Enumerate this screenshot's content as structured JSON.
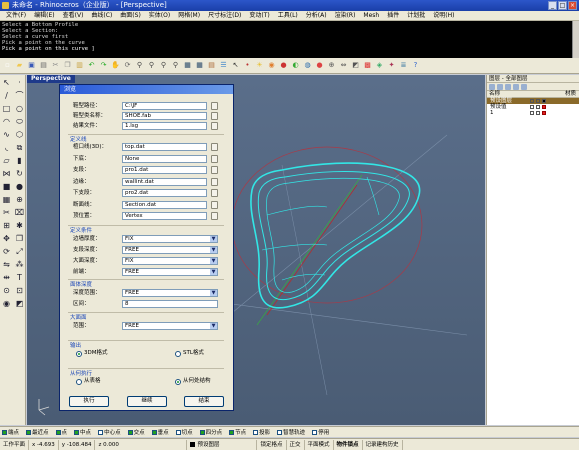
{
  "title_bar": {
    "text": "未命名 - Rhinoceros（企业版） - [Perspective]",
    "buttons": [
      "_",
      "□",
      "×"
    ]
  },
  "menu": [
    "文件(F)",
    "编辑(E)",
    "查看(V)",
    "曲线(C)",
    "曲面(S)",
    "实体(O)",
    "网格(M)",
    "尺寸标注(D)",
    "变动(T)",
    "工具(L)",
    "分析(A)",
    "渲染(R)",
    "Mesh",
    "插件",
    "计划批",
    "说明(H)"
  ],
  "command_history": [
    "Select a Bottom Profile",
    "Select a Section:",
    "Select a curve first",
    "Pick a point on the curve",
    "Pick a point on this curve ]"
  ],
  "viewport": {
    "label": "Perspective",
    "mesh_color": "#32e6e6"
  },
  "dialog": {
    "title": "浏览",
    "top_fields": [
      {
        "label": "鞋型路径：",
        "value": "C:\\JF"
      },
      {
        "label": "鞋型类名称：",
        "value": "SHOE.fab"
      },
      {
        "label": "结果文件：",
        "value": "1.lsg"
      }
    ],
    "group_define": "定义线",
    "define_fields": [
      {
        "label": "楦口线(3D)：",
        "value": "top.dat"
      },
      {
        "label": "下底：",
        "value": "None"
      },
      {
        "label": "支段：",
        "value": "pro1.dat"
      },
      {
        "label": "边缘：",
        "value": "wallint.dat"
      },
      {
        "label": "下支段：",
        "value": "pro2.dat"
      },
      {
        "label": "断面线：",
        "value": "Section.dat"
      },
      {
        "label": "顶位置：",
        "value": "Vertex"
      }
    ],
    "group_conditions": "定义条件",
    "condition_fields": [
      {
        "label": "边墙厚度：",
        "value": "FIX"
      },
      {
        "label": "支段深度：",
        "value": "FREE"
      },
      {
        "label": "大面深度：",
        "value": "FIX"
      },
      {
        "label": "前端：",
        "value": "FREE"
      }
    ],
    "group_range": "面体深度",
    "range_field": {
      "label": "深度范围：",
      "value": "FREE"
    },
    "interval_field": {
      "label": "区间：",
      "value": "8"
    },
    "group_large": "大面面",
    "large_field": {
      "label": "范围：",
      "value": "FREE"
    },
    "group_output": "输出",
    "output_options": [
      "3DM格式",
      "STL格式"
    ],
    "output_selected": 0,
    "group_exec": "从何执行",
    "exec_options": [
      "从表格",
      "从何处结构"
    ],
    "exec_selected": 1,
    "buttons": {
      "execute": "执行",
      "continue": "继续",
      "finish": "结束"
    }
  },
  "layer_panel": {
    "title": "图层 - 全部图层",
    "col_name": "名称",
    "col_material": "材质",
    "rows": [
      {
        "name": "预设图层",
        "selected": true
      },
      {
        "name": "预设值",
        "selected": false
      },
      {
        "name": "1",
        "selected": false
      }
    ]
  },
  "osnap": [
    {
      "label": "端点",
      "on": true
    },
    {
      "label": "最近点",
      "on": true
    },
    {
      "label": "点",
      "on": true
    },
    {
      "label": "中点",
      "on": true
    },
    {
      "label": "中心点",
      "on": false
    },
    {
      "label": "交点",
      "on": true
    },
    {
      "label": "垂点",
      "on": true
    },
    {
      "label": "切点",
      "on": false
    },
    {
      "label": "四分点",
      "on": true
    },
    {
      "label": "节点",
      "on": true
    },
    {
      "label": "投影",
      "on": false
    },
    {
      "label": "智慧轨迹",
      "on": false
    },
    {
      "label": "停用",
      "on": false
    }
  ],
  "status": {
    "plane": "工作平面",
    "x": "x -4.693",
    "y": "y -108.484",
    "z": "z 0.000",
    "layer": "预设图层",
    "locks": [
      "锁定格点",
      "正交",
      "平面模式",
      "物件锁点",
      "记录建构历史"
    ]
  }
}
